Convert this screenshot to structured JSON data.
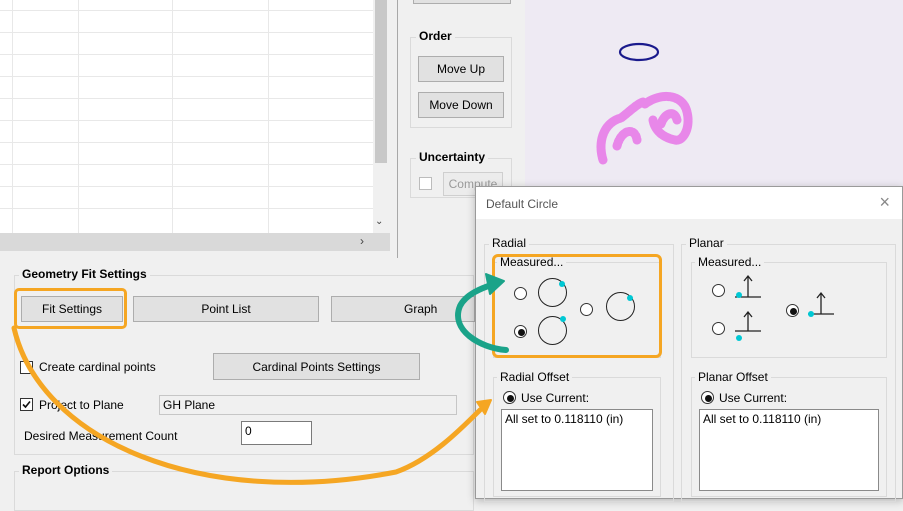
{
  "order": {
    "title": "Order",
    "move_up": "Move Up",
    "move_down": "Move Down"
  },
  "uncertainty": {
    "title": "Uncertainty",
    "compute": "Compute"
  },
  "geometry": {
    "title": "Geometry Fit Settings",
    "fit_settings": "Fit Settings",
    "point_list": "Point List",
    "graph": "Graph",
    "create_cardinal": "Create cardinal points",
    "cardinal_settings": "Cardinal Points Settings",
    "project_to_plane": "Project to Plane",
    "plane_value": "GH Plane",
    "desired_count_label": "Desired Measurement Count",
    "desired_count_value": "0"
  },
  "report": {
    "title": "Report Options"
  },
  "dialog": {
    "title": "Default Circle",
    "close": "×",
    "radial": {
      "title": "Radial",
      "measured": "Measured...",
      "offset_title": "Radial Offset",
      "use_current": "Use Current:",
      "offset_text": "All set to 0.118110 (in)"
    },
    "planar": {
      "title": "Planar",
      "measured": "Measured...",
      "offset_title": "Planar Offset",
      "use_current": "Use Current:",
      "offset_text": "All set to 0.118110 (in)"
    }
  },
  "colors": {
    "highlight": "#f5a623",
    "arrow_teal": "#1aa389",
    "accent_dot": "#00c8d4",
    "ellipse": "#1a1a8c",
    "point_cloud": "#e87de8"
  }
}
